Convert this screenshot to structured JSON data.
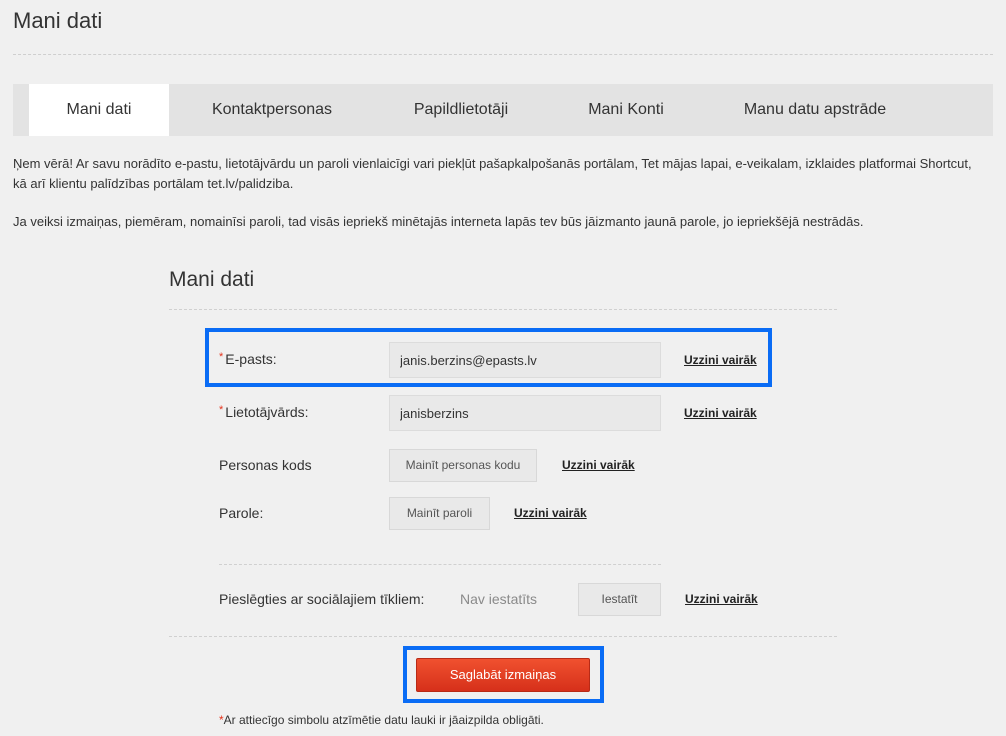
{
  "page": {
    "title": "Mani dati"
  },
  "tabs": [
    {
      "label": "Mani dati",
      "active": true
    },
    {
      "label": "Kontaktpersonas",
      "active": false
    },
    {
      "label": "Papildlietotāji",
      "active": false
    },
    {
      "label": "Mani Konti",
      "active": false
    },
    {
      "label": "Manu datu apstrāde",
      "active": false
    }
  ],
  "notice": {
    "paragraph1": "Ņem vērā! Ar savu norādīto e-pastu, lietotājvārdu un paroli vienlaicīgi vari piekļūt pašapkalpošanās portālam, Tet mājas lapai, e-veikalam, izklaides platformai Shortcut, kā arī klientu palīdzības portālam tet.lv/palidziba.",
    "paragraph2": "Ja veiksi izmaiņas, piemēram, nomainīsi paroli, tad visās iepriekš minētajās interneta lapās tev būs jāizmanto jaunā parole, jo iepriekšējā nestrādās."
  },
  "form": {
    "title": "Mani dati",
    "required_mark": "*",
    "email": {
      "label": "E-pasts:",
      "value": "janis.berzins@epasts.lv",
      "link": "Uzzini vairāk"
    },
    "username": {
      "label": "Lietotājvārds:",
      "value": "janisberzins",
      "link": "Uzzini vairāk"
    },
    "personal_code": {
      "label": "Personas kods",
      "button": "Mainīt personas kodu",
      "link": "Uzzini vairāk"
    },
    "password": {
      "label": "Parole:",
      "button": "Mainīt paroli",
      "link": "Uzzini vairāk"
    },
    "social": {
      "label": "Pieslēgties ar sociālajiem tīkliem:",
      "status": "Nav iestatīts",
      "button": "Iestatīt",
      "link": "Uzzini vairāk"
    },
    "save_button": "Saglabāt izmaiņas",
    "footnote": "Ar attiecīgo simbolu atzīmētie datu lauki ir jāaizpilda obligāti."
  },
  "colors": {
    "accent_red": "#e4321b",
    "highlight_blue": "#0a6cf5"
  }
}
